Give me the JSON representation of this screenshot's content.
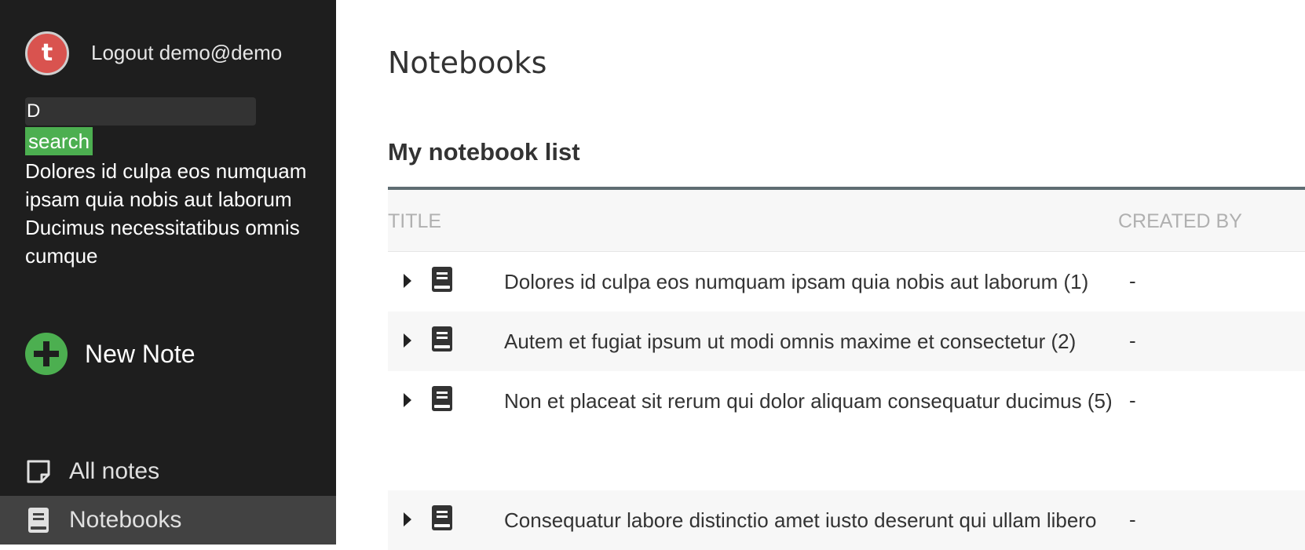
{
  "sidebar": {
    "avatar_letter": "t",
    "logout_text": "Logout demo@demo",
    "search": {
      "value": "D",
      "button_label": "search"
    },
    "search_results": [
      "Dolores id culpa eos numquam ipsam quia nobis aut laborum",
      "Ducimus necessitatibus omnis cumque"
    ],
    "new_note_label": "New Note",
    "nav": [
      {
        "label": "All notes",
        "icon": "note-icon"
      },
      {
        "label": "Notebooks",
        "icon": "notebook-icon",
        "active": true
      }
    ]
  },
  "main": {
    "page_title": "Notebooks",
    "section_title": "My notebook list",
    "table": {
      "columns": [
        "TITLE",
        "CREATED BY"
      ],
      "rows": [
        {
          "title": "Dolores id culpa eos numquam ipsam quia nobis aut laborum (1)",
          "created_by": "-"
        },
        {
          "title": "Autem et fugiat ipsum ut modi omnis maxime et consectetur (2)",
          "created_by": "-"
        },
        {
          "title": "Non et placeat sit rerum qui dolor aliquam consequatur ducimus (5)",
          "created_by": "-"
        },
        {
          "title": "Consequatur labore distinctio amet iusto deserunt qui ullam libero",
          "created_by": "-"
        }
      ]
    }
  },
  "colors": {
    "sidebar_bg": "#1e1e1e",
    "accent_green": "#4caf50",
    "avatar_red": "#d9534f",
    "active_nav_bg": "#424242"
  }
}
